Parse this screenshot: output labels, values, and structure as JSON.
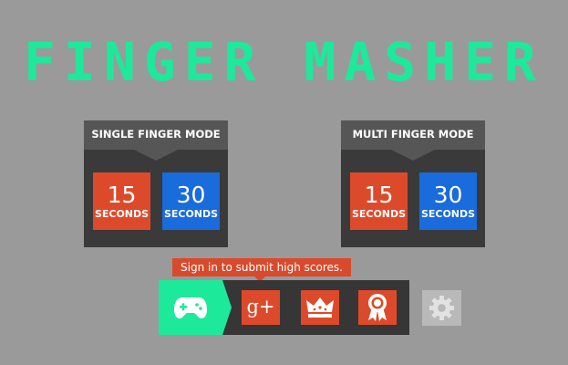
{
  "title": "FINGER MASHER",
  "single_mode": {
    "heading": "SINGLE FINGER MODE",
    "options": [
      {
        "number": "15",
        "unit": "SECONDS"
      },
      {
        "number": "30",
        "unit": "SECONDS"
      }
    ]
  },
  "multi_mode": {
    "heading": "MULTI FINGER MODE",
    "options": [
      {
        "number": "15",
        "unit": "SECONDS"
      },
      {
        "number": "30",
        "unit": "SECONDS"
      }
    ]
  },
  "signin_tooltip": "Sign in to submit high scores.",
  "google_plus_label": "g+",
  "icons": [
    "gamepad-icon",
    "google-plus-icon",
    "crown-icon",
    "award-ribbon-icon",
    "gear-icon"
  ],
  "colors": {
    "background": "#9a9a9a",
    "title": "#1de99b",
    "red_tile": "#dd4a2b",
    "blue_tile": "#1a6bdc",
    "panel": "#3a3a3a",
    "panel_header": "#565656"
  }
}
